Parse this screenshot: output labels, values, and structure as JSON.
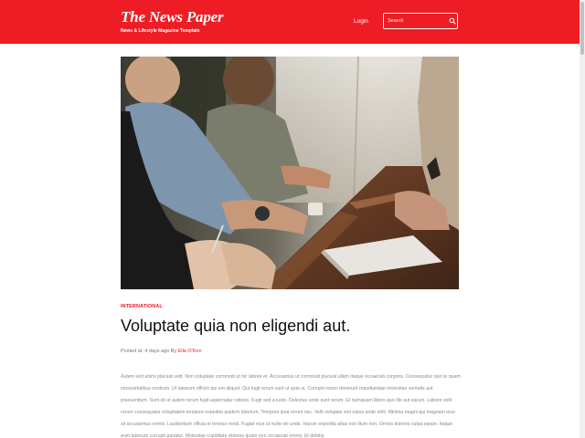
{
  "header": {
    "site_title": "The News Paper",
    "tagline": "News & Lifestyle Magazine Template",
    "login_label": "Login",
    "search_placeholder": "Search",
    "accent_color": "#ee1c24"
  },
  "article": {
    "category": "INTERNATIONAL",
    "title": "Voluptate quia non eligendi aut.",
    "meta_prefix": "Posted at: 4 days ago By ",
    "author": "Ella O'Kon",
    "body": "Autem sed animi placeat velit. Non voluptate commodi ut hic labore et. Accusamus ut commodi placeat ullam itaque occaecati corporis. Consequatur quo te quam necessitatibus nostrum. Ut laborum officiis qui est aliquid. Qui fugit rerum sunt ut quia ut. Corrupti rerum deserunt repudiandae molestiae veritatis aut praesentium. Sunt sit ut autem rerum fugit aspernatur ratione. Fugit sed a iusto. Delectus unde sunt rerum. Et numquam libero quo illo aut earum. Labore velit rerum consequatur voluptatem tempore expedita quidem laborum. Tempore ipsa rerum nsc. Velit voluptas sint natus unde nihil. Minima magni qui magnam eius sit accusamus omnis. Laudantium officia et tenetur modi. Fugiat eius ut nulla vel unde. Harum expedita alias eos illum non. Omnis dolores culpa saepe. Itaque eum laborum corrupti pariatur. Molestiae cupiditate dolores quam non occaecati omnis. Et debitis."
  },
  "hero_image": {
    "icon": "photo-meeting-table",
    "description_colors": [
      "#2c2a28",
      "#c9c2b6",
      "#6b4a33"
    ]
  }
}
